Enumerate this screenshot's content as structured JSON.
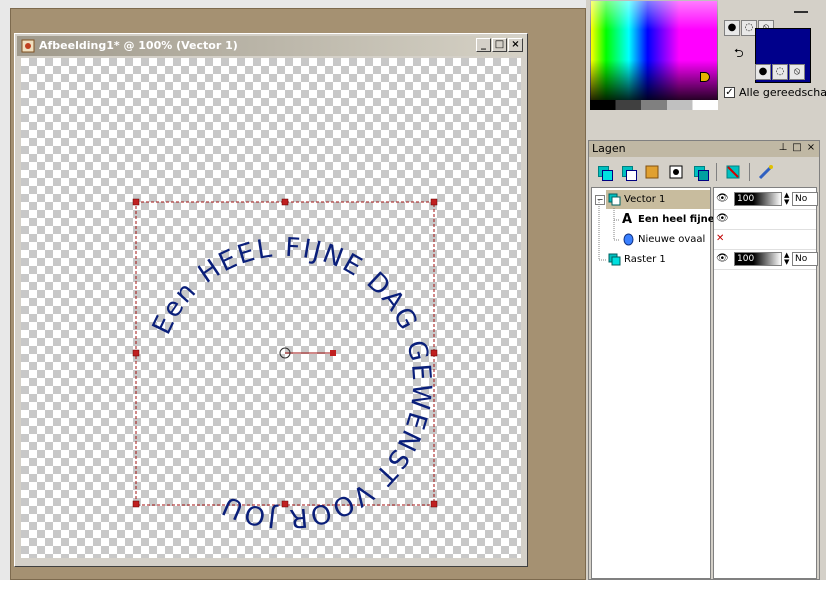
{
  "image_window": {
    "title": "Afbeelding1* @ 100% (Vector 1)",
    "buttons": {
      "minimize": "_",
      "maximize": "□",
      "close": "×"
    }
  },
  "canvas_text": {
    "circle_text": "Een heel fijne dag gewenst voor jou",
    "text_color": "#0a1f7a"
  },
  "colors": {
    "foreground": "#00008b",
    "background": "#00008b",
    "checkbox_label": "Alle gereedschap",
    "checkbox_checked": true
  },
  "layers_palette": {
    "title": "Lagen",
    "layers": [
      {
        "name": "Vector 1",
        "type": "vector-layer",
        "selected": true,
        "opacity": "100",
        "blend": "No"
      },
      {
        "name": "Een heel fijne",
        "type": "text-object",
        "selected": false
      },
      {
        "name": "Nieuwe ovaal",
        "type": "ellipse-object",
        "selected": false
      },
      {
        "name": "Raster 1",
        "type": "raster-layer",
        "selected": false,
        "opacity": "100",
        "blend": "No"
      }
    ]
  }
}
